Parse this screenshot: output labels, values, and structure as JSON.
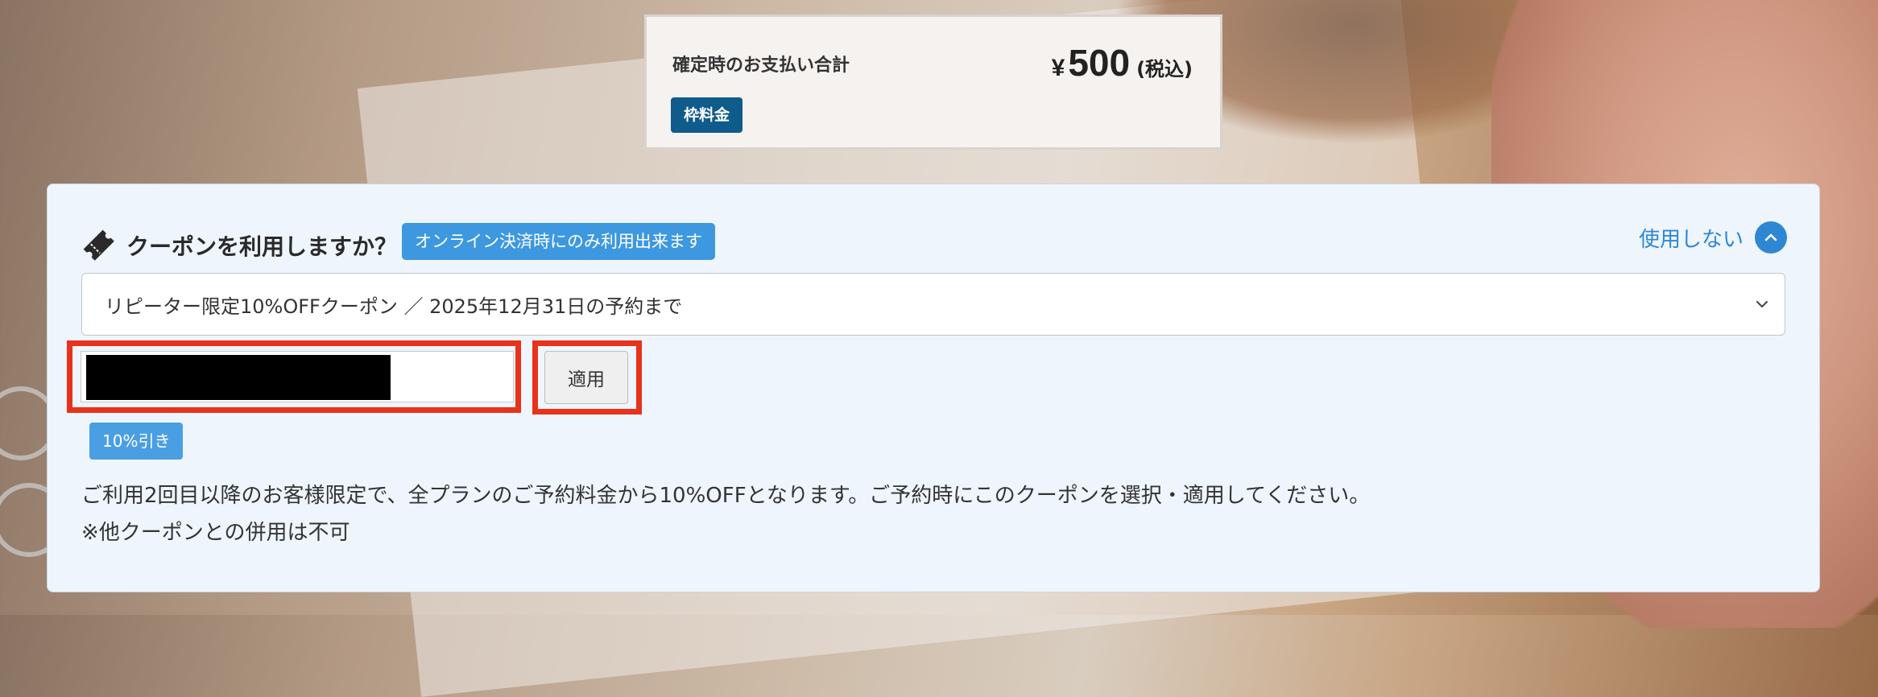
{
  "summary": {
    "label": "確定時のお支払い合計",
    "currency_symbol": "¥",
    "amount": "500",
    "tax_note": "(税込)",
    "badge": "枠料金"
  },
  "coupon": {
    "title": "クーポンを利用しますか？",
    "online_badge": "オンライン決済時にのみ利用出来ます",
    "toggle_label": "使用しない",
    "selected_coupon": "リピーター限定10%OFFクーポン ／ 2025年12月31日の予約まで",
    "apply_label": "適用",
    "discount_badge": "10%引き",
    "description_line1": "ご利用2回目以降のお客様限定で、全プランのご予約料金から10%OFFとなります。ご予約時にこのクーポンを選択・適用してください。",
    "description_line2": "※他クーポンとの併用は不可"
  },
  "colors": {
    "accent": "#2f87d4",
    "badge_dark": "#0f5b8c",
    "highlight": "#e8321b"
  }
}
